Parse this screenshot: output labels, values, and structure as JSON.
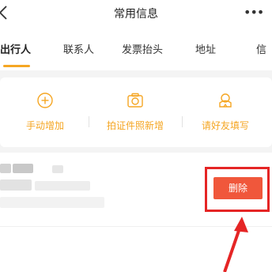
{
  "header": {
    "title": "常用信息",
    "more": "•••"
  },
  "tabs": [
    {
      "label": "出行人",
      "active": true
    },
    {
      "label": "联系人",
      "active": false
    },
    {
      "label": "发票抬头",
      "active": false
    },
    {
      "label": "地址",
      "active": false
    },
    {
      "label": "信",
      "active": false
    }
  ],
  "actions": [
    {
      "label": "手动增加",
      "icon": "plus-circle-icon"
    },
    {
      "label": "拍证件照新增",
      "icon": "camera-icon"
    },
    {
      "label": "请好友填写",
      "icon": "friend-icon"
    }
  ],
  "traveler_row": {
    "delete_label": "删除"
  },
  "colors": {
    "accent": "#f5a623",
    "delete": "#f0573b",
    "highlight": "#e52525",
    "band": "#f4f4f4"
  }
}
